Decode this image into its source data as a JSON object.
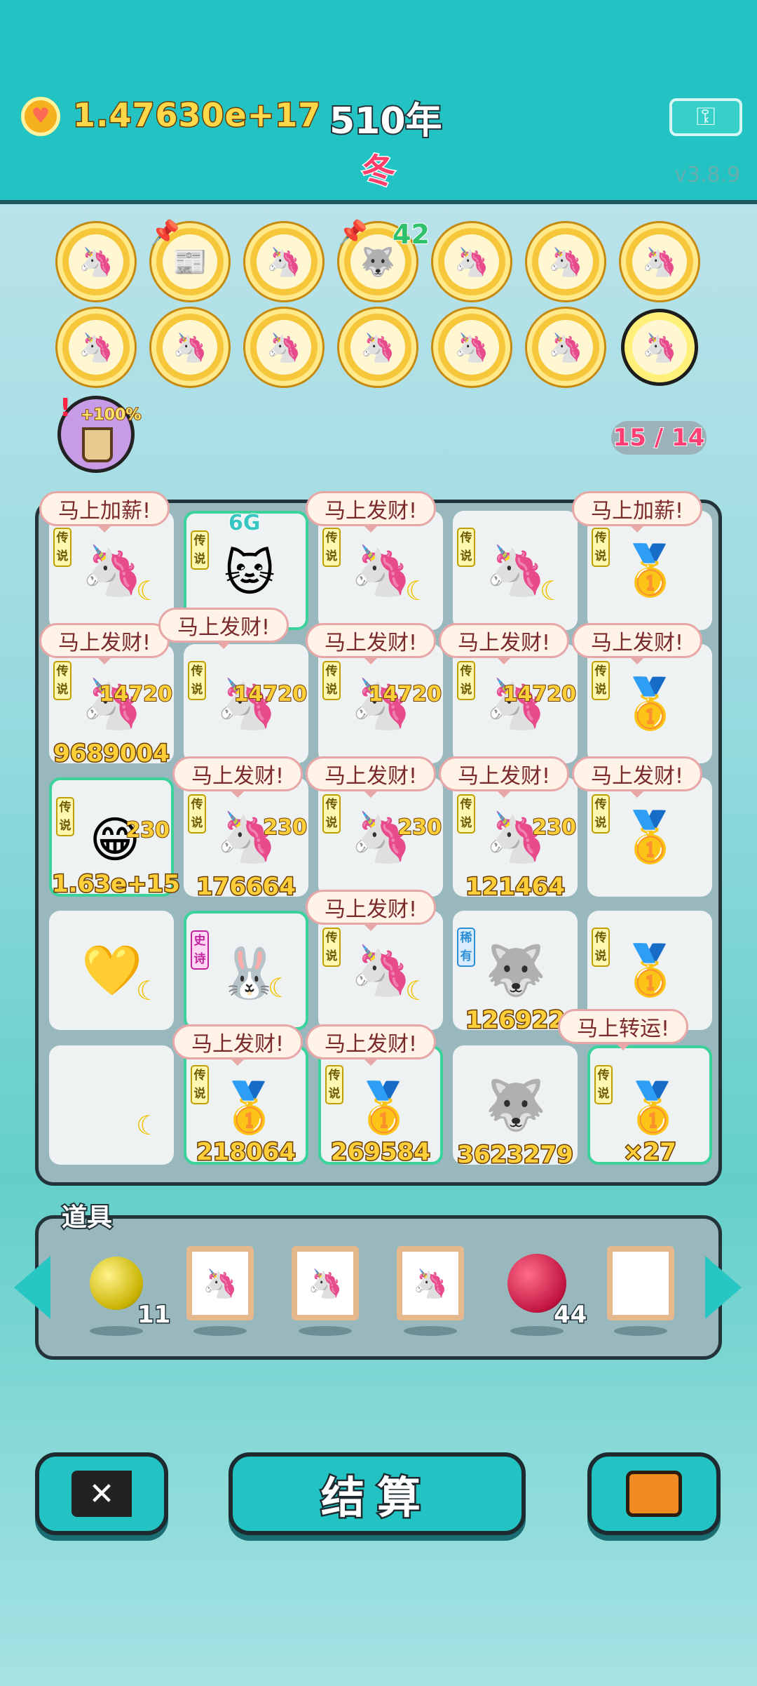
{
  "header": {
    "money": "1.47630e+17",
    "year": "510年",
    "season": "冬",
    "version": "v3.8.9",
    "coin_icon": "heart-coin-icon",
    "key_icon": "key-icon"
  },
  "top_avatars": [
    {
      "pic": "🦄"
    },
    {
      "pic": "📰"
    },
    {
      "pic": "🦄"
    },
    {
      "pic": "🐺"
    },
    {
      "pic": "🦄"
    },
    {
      "pic": "🦄"
    },
    {
      "pic": "🦄"
    },
    {
      "pic": "🦄"
    },
    {
      "pic": "🦄"
    },
    {
      "pic": "🦄"
    },
    {
      "pic": "🦄"
    },
    {
      "pic": "🦄"
    },
    {
      "pic": "🦄"
    },
    {
      "pic": "🦄"
    }
  ],
  "level_badge": "42",
  "buff": {
    "text": "+100%",
    "alert": "!"
  },
  "counter": "15 / 14",
  "tags": {
    "legend": "传说",
    "epic": "史诗",
    "rare": "稀有"
  },
  "board": {
    "rows": [
      [
        "",
        "",
        "",
        "",
        ""
      ],
      [
        "9689004",
        "",
        "",
        "",
        ""
      ],
      [
        "1.63e+15",
        "176664",
        "",
        "121464",
        ""
      ],
      [
        "",
        "",
        "",
        "126922",
        ""
      ],
      [
        "",
        "218064",
        "269584",
        "3623279",
        "×27"
      ]
    ],
    "subs": {
      "r1": "14720",
      "r2": "230"
    },
    "top_label": "6G"
  },
  "bubbles": {
    "raise": "马上加薪!",
    "rich": "马上发财!",
    "luck": "马上转运!"
  },
  "props": {
    "title": "道具",
    "ball_qty": "11",
    "berry_qty": "44"
  },
  "buttons": {
    "settle": "结算"
  }
}
